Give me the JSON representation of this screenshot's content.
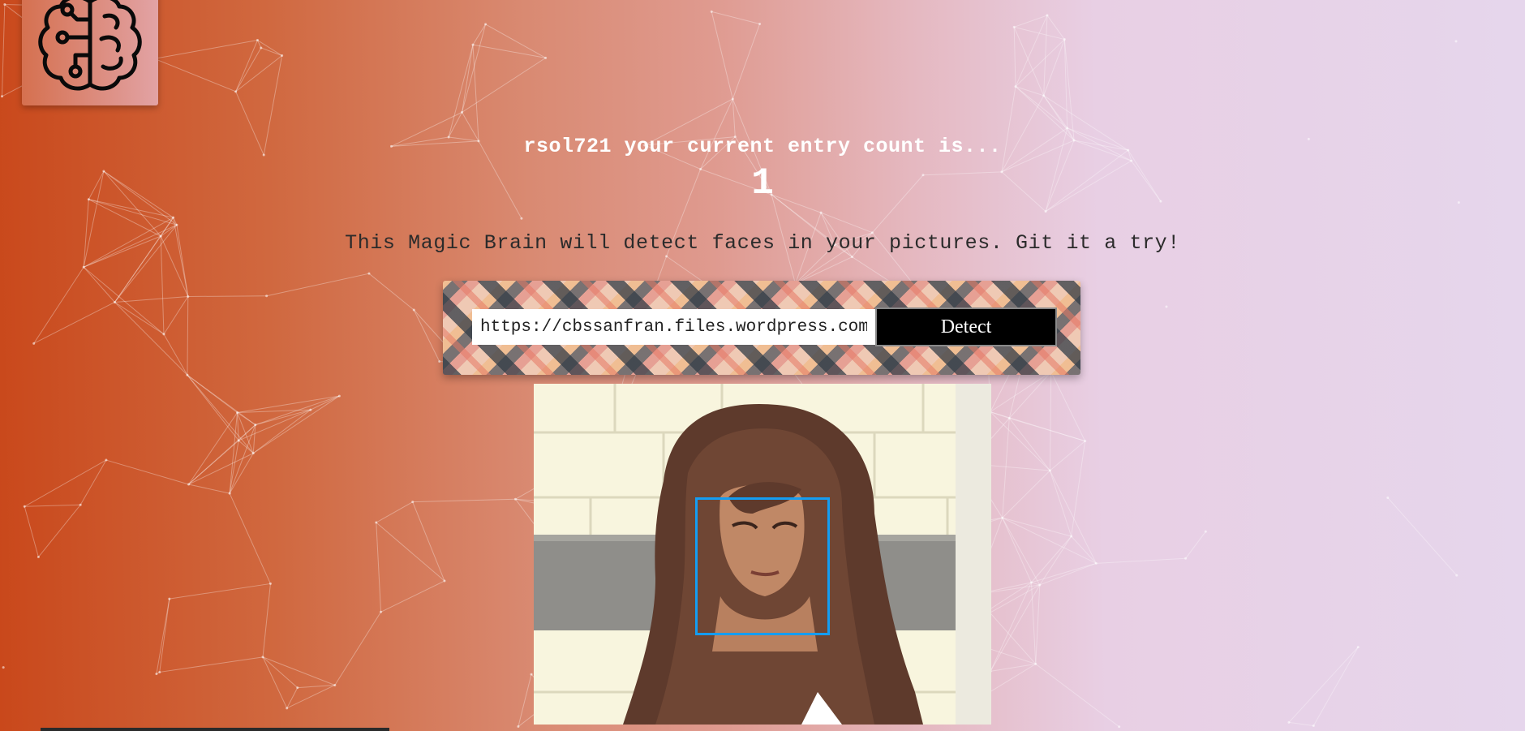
{
  "app": {
    "logo_icon": "brain-circuit-icon"
  },
  "entry": {
    "username": "rsol721",
    "message": "rsol721 your current entry count is...",
    "count": "1"
  },
  "tagline": "This Magic Brain will detect faces in your pictures. Git it a try!",
  "detect_form": {
    "input_value": "https://cbssanfran.files.wordpress.com",
    "button_label": "Detect"
  },
  "result": {
    "image_alt": "Uploaded photo with detected face",
    "face_box_color": "#149df2"
  },
  "colors": {
    "gradient_start": "#c9481b",
    "gradient_end": "#e6d6ec",
    "button_bg": "#000000"
  }
}
